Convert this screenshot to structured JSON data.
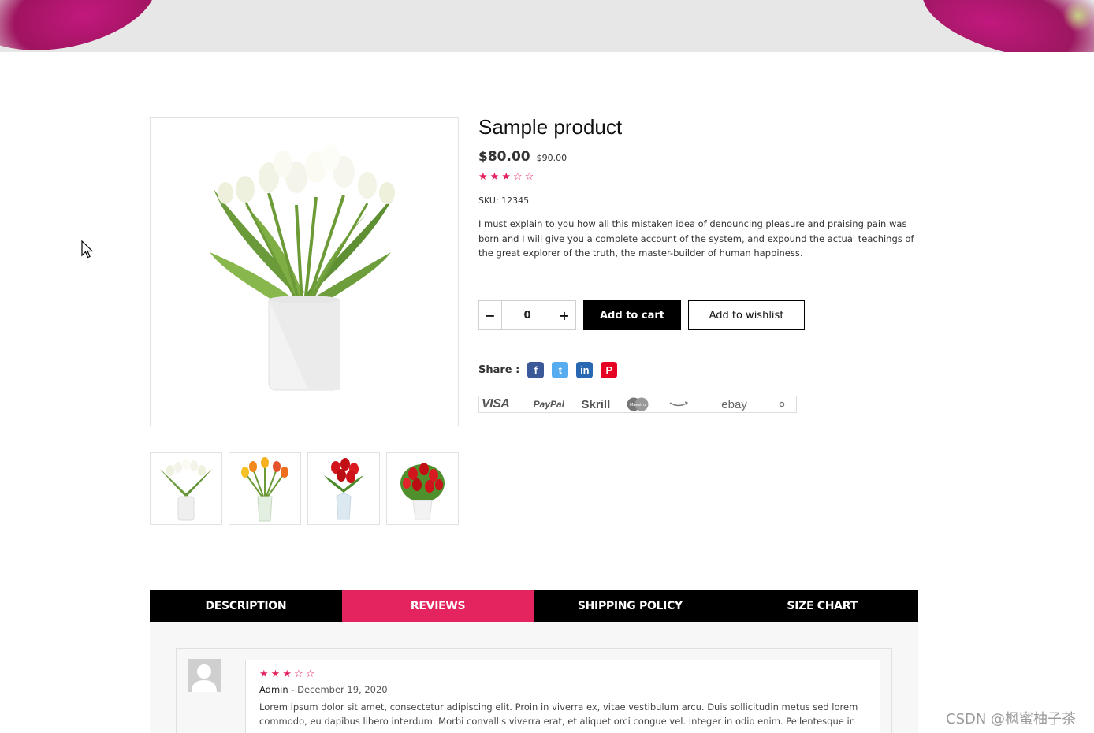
{
  "product": {
    "title": "Sample product",
    "price": "$80.00",
    "old_price": "$90.00",
    "rating": 3,
    "rating_max": 5,
    "sku": "SKU: 12345",
    "description": "I must explain to you how all this mistaken idea of denouncing pleasure and praising pain was born and I will give you a complete account of the system, and expound the actual teachings of the great explorer of the truth, the master-builder of human happiness."
  },
  "gallery": {
    "main_icon": "white-tulips-vase-image",
    "thumbnails": [
      {
        "icon": "white-tulips-thumbnail"
      },
      {
        "icon": "yellow-tulips-thumbnail"
      },
      {
        "icon": "red-tulips-thumbnail"
      },
      {
        "icon": "red-bouquet-thumbnail"
      }
    ]
  },
  "cart": {
    "minus_label": "−",
    "quantity": "0",
    "plus_label": "+",
    "add_to_cart_label": "Add to cart",
    "add_to_wishlist_label": "Add to wishlist"
  },
  "share": {
    "label": "Share :",
    "networks": [
      {
        "name": "facebook",
        "glyph": "f",
        "color": "#3b5998"
      },
      {
        "name": "twitter",
        "glyph": "t",
        "color": "#55acee"
      },
      {
        "name": "linkedin",
        "glyph": "in",
        "color": "#2867b2"
      },
      {
        "name": "pinterest",
        "glyph": "P",
        "color": "#e60023"
      }
    ]
  },
  "payments": {
    "visa": "VISA",
    "paypal": "PayPal",
    "skrill": "Skrill",
    "maestro": "Maestro",
    "ebay": "ebay"
  },
  "tabs": [
    {
      "label": "DESCRIPTION",
      "active": false
    },
    {
      "label": "REVIEWS",
      "active": true
    },
    {
      "label": "SHIPPING POLICY",
      "active": false
    },
    {
      "label": "SIZE CHART",
      "active": false
    }
  ],
  "review": {
    "rating": 3,
    "author": "Admin",
    "separator": " - ",
    "date": "December 19, 2020",
    "text": "Lorem ipsum dolor sit amet, consectetur adipiscing elit. Proin in viverra ex, vitae vestibulum arcu. Duis sollicitudin metus sed lorem commodo, eu dapibus libero interdum. Morbi convallis viverra erat, et aliquet orci congue vel. Integer in odio enim. Pellentesque in"
  },
  "watermark": "CSDN @枫蜜柚子茶",
  "colors": {
    "accent": "#e4245e",
    "dark": "#000000",
    "panel": "#f7f7f7"
  }
}
